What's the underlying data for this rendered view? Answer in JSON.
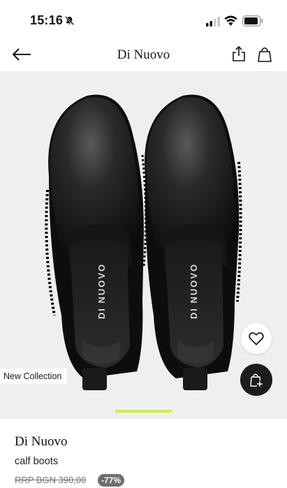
{
  "status_bar": {
    "time": "15:16"
  },
  "header": {
    "title": "Di Nuovo"
  },
  "gallery": {
    "badge": "New Collection",
    "insole_logo_text": "DI NUOVO"
  },
  "product": {
    "brand": "Di Nuovo",
    "name": "calf boots",
    "rrp": "RRP BGN 390,00",
    "discount": "-77%"
  },
  "colors": {
    "accent": "#c6f34a",
    "dark_button": "#1c1c1c",
    "gallery_bg": "#efefef",
    "discount_badge": "#6e6e6e"
  },
  "icons": {
    "back": "arrow-left-icon",
    "share": "share-icon",
    "bag": "shopping-bag-icon",
    "wishlist": "heart-icon",
    "add_to_bag": "bag-plus-icon"
  }
}
